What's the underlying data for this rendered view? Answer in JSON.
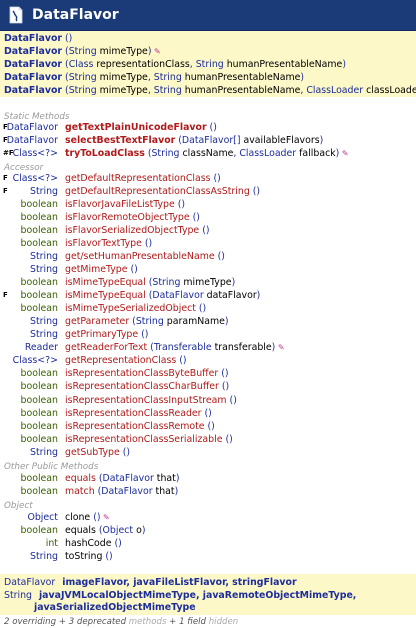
{
  "window": {
    "title": "DataFlavor"
  },
  "constructors": [
    [
      "DataFlavor",
      " ()",
      ""
    ],
    [
      "DataFlavor",
      " (String mimeType)",
      " ✎"
    ],
    [
      "DataFlavor",
      " (Class<?> representationClass, String humanPresentableName)",
      ""
    ],
    [
      "DataFlavor",
      " (String mimeType, String humanPresentableName)",
      ""
    ],
    [
      "DataFlavor",
      " (String mimeType, String humanPresentableName, ClassLoader classLoader)",
      " ✎"
    ]
  ],
  "sections": {
    "static_methods": "Static Methods",
    "accessor": "Accessor",
    "other_public": "Other Public Methods",
    "object": "Object"
  },
  "static_methods": [
    {
      "mark": "F",
      "type": "DataFlavor",
      "name": "getTextPlainUnicodeFlavor",
      "params": " ()",
      "edit": ""
    },
    {
      "mark": "F",
      "type": "DataFlavor",
      "name": "selectBestTextFlavor",
      "params": " (DataFlavor[] availableFlavors)",
      "edit": ""
    },
    {
      "mark": "#F",
      "type": "Class<?>",
      "name": "tryToLoadClass",
      "params": " (String className, ClassLoader fallback)",
      "edit": " ✎"
    }
  ],
  "accessors": [
    {
      "mark": "F",
      "type": "Class<?>",
      "name": "getDefaultRepresentationClass",
      "params": " ()",
      "edit": ""
    },
    {
      "mark": "F",
      "type": "String",
      "name": "getDefaultRepresentationClassAsString",
      "params": " ()",
      "edit": ""
    },
    {
      "mark": "",
      "type": "boolean",
      "name": "isFlavorJavaFileListType",
      "params": " ()",
      "edit": ""
    },
    {
      "mark": "",
      "type": "boolean",
      "name": "isFlavorRemoteObjectType",
      "params": " ()",
      "edit": ""
    },
    {
      "mark": "",
      "type": "boolean",
      "name": "isFlavorSerializedObjectType",
      "params": " ()",
      "edit": ""
    },
    {
      "mark": "",
      "type": "boolean",
      "name": "isFlavorTextType",
      "params": " ()",
      "edit": ""
    },
    {
      "mark": "",
      "type": "String",
      "name": "get/setHumanPresentableName",
      "params": " ()",
      "edit": ""
    },
    {
      "mark": "",
      "type": "String",
      "name": "getMimeType",
      "params": " ()",
      "edit": ""
    },
    {
      "mark": "",
      "type": "boolean",
      "name": "isMimeTypeEqual",
      "params": " (String mimeType)",
      "edit": ""
    },
    {
      "mark": "F",
      "type": "boolean",
      "name": "isMimeTypeEqual",
      "params": " (DataFlavor dataFlavor)",
      "edit": ""
    },
    {
      "mark": "",
      "type": "boolean",
      "name": "isMimeTypeSerializedObject",
      "params": " ()",
      "edit": ""
    },
    {
      "mark": "",
      "type": "String",
      "name": "getParameter",
      "params": " (String paramName)",
      "edit": ""
    },
    {
      "mark": "",
      "type": "String",
      "name": "getPrimaryType",
      "params": " ()",
      "edit": ""
    },
    {
      "mark": "",
      "type": "Reader",
      "name": "getReaderForText",
      "params": " (Transferable transferable)",
      "edit": " ✎"
    },
    {
      "mark": "",
      "type": "Class<?>",
      "name": "getRepresentationClass",
      "params": " ()",
      "edit": ""
    },
    {
      "mark": "",
      "type": "boolean",
      "name": "isRepresentationClassByteBuffer",
      "params": " ()",
      "edit": ""
    },
    {
      "mark": "",
      "type": "boolean",
      "name": "isRepresentationClassCharBuffer",
      "params": " ()",
      "edit": ""
    },
    {
      "mark": "",
      "type": "boolean",
      "name": "isRepresentationClassInputStream",
      "params": " ()",
      "edit": ""
    },
    {
      "mark": "",
      "type": "boolean",
      "name": "isRepresentationClassReader",
      "params": " ()",
      "edit": ""
    },
    {
      "mark": "",
      "type": "boolean",
      "name": "isRepresentationClassRemote",
      "params": " ()",
      "edit": ""
    },
    {
      "mark": "",
      "type": "boolean",
      "name": "isRepresentationClassSerializable",
      "params": " ()",
      "edit": ""
    },
    {
      "mark": "",
      "type": "String",
      "name": "getSubType",
      "params": " ()",
      "edit": ""
    }
  ],
  "other_public": [
    {
      "type": "boolean",
      "name": "equals",
      "params": " (DataFlavor that)"
    },
    {
      "type": "boolean",
      "name": "match",
      "params": " (DataFlavor that)"
    }
  ],
  "object_methods": [
    {
      "type": "Object",
      "name": "clone",
      "params": " ()",
      "edit": " ✎"
    },
    {
      "type": "boolean",
      "name": "equals",
      "params": " (Object o)",
      "edit": ""
    },
    {
      "type": "int",
      "name": "hashCode",
      "params": " ()",
      "edit": ""
    },
    {
      "type": "String",
      "name": "toString",
      "params": " ()",
      "edit": ""
    }
  ],
  "fields": {
    "row1_type": "DataFlavor",
    "row1_names": "imageFlavor, javaFileListFlavor, stringFlavor",
    "row2_type": "String",
    "row2_names": "javaJVMLocalObjectMimeType, javaRemoteObjectMimeType,",
    "row3_names": "javaSerializedObjectMimeType"
  },
  "footer": {
    "overriding": "2 overriding",
    "sep1": " + ",
    "deprecated": "3 deprecated",
    "methods": " methods",
    "sep2": " + ",
    "field": "1 field",
    "hidden": " hidden"
  },
  "colors": {
    "header_bg": "#1a3a78",
    "highlight_bg": "#fdf8c8",
    "type_blue": "#1c2d9c",
    "primitive_olive": "#3a5f00",
    "method_red": "#b01a1a"
  }
}
